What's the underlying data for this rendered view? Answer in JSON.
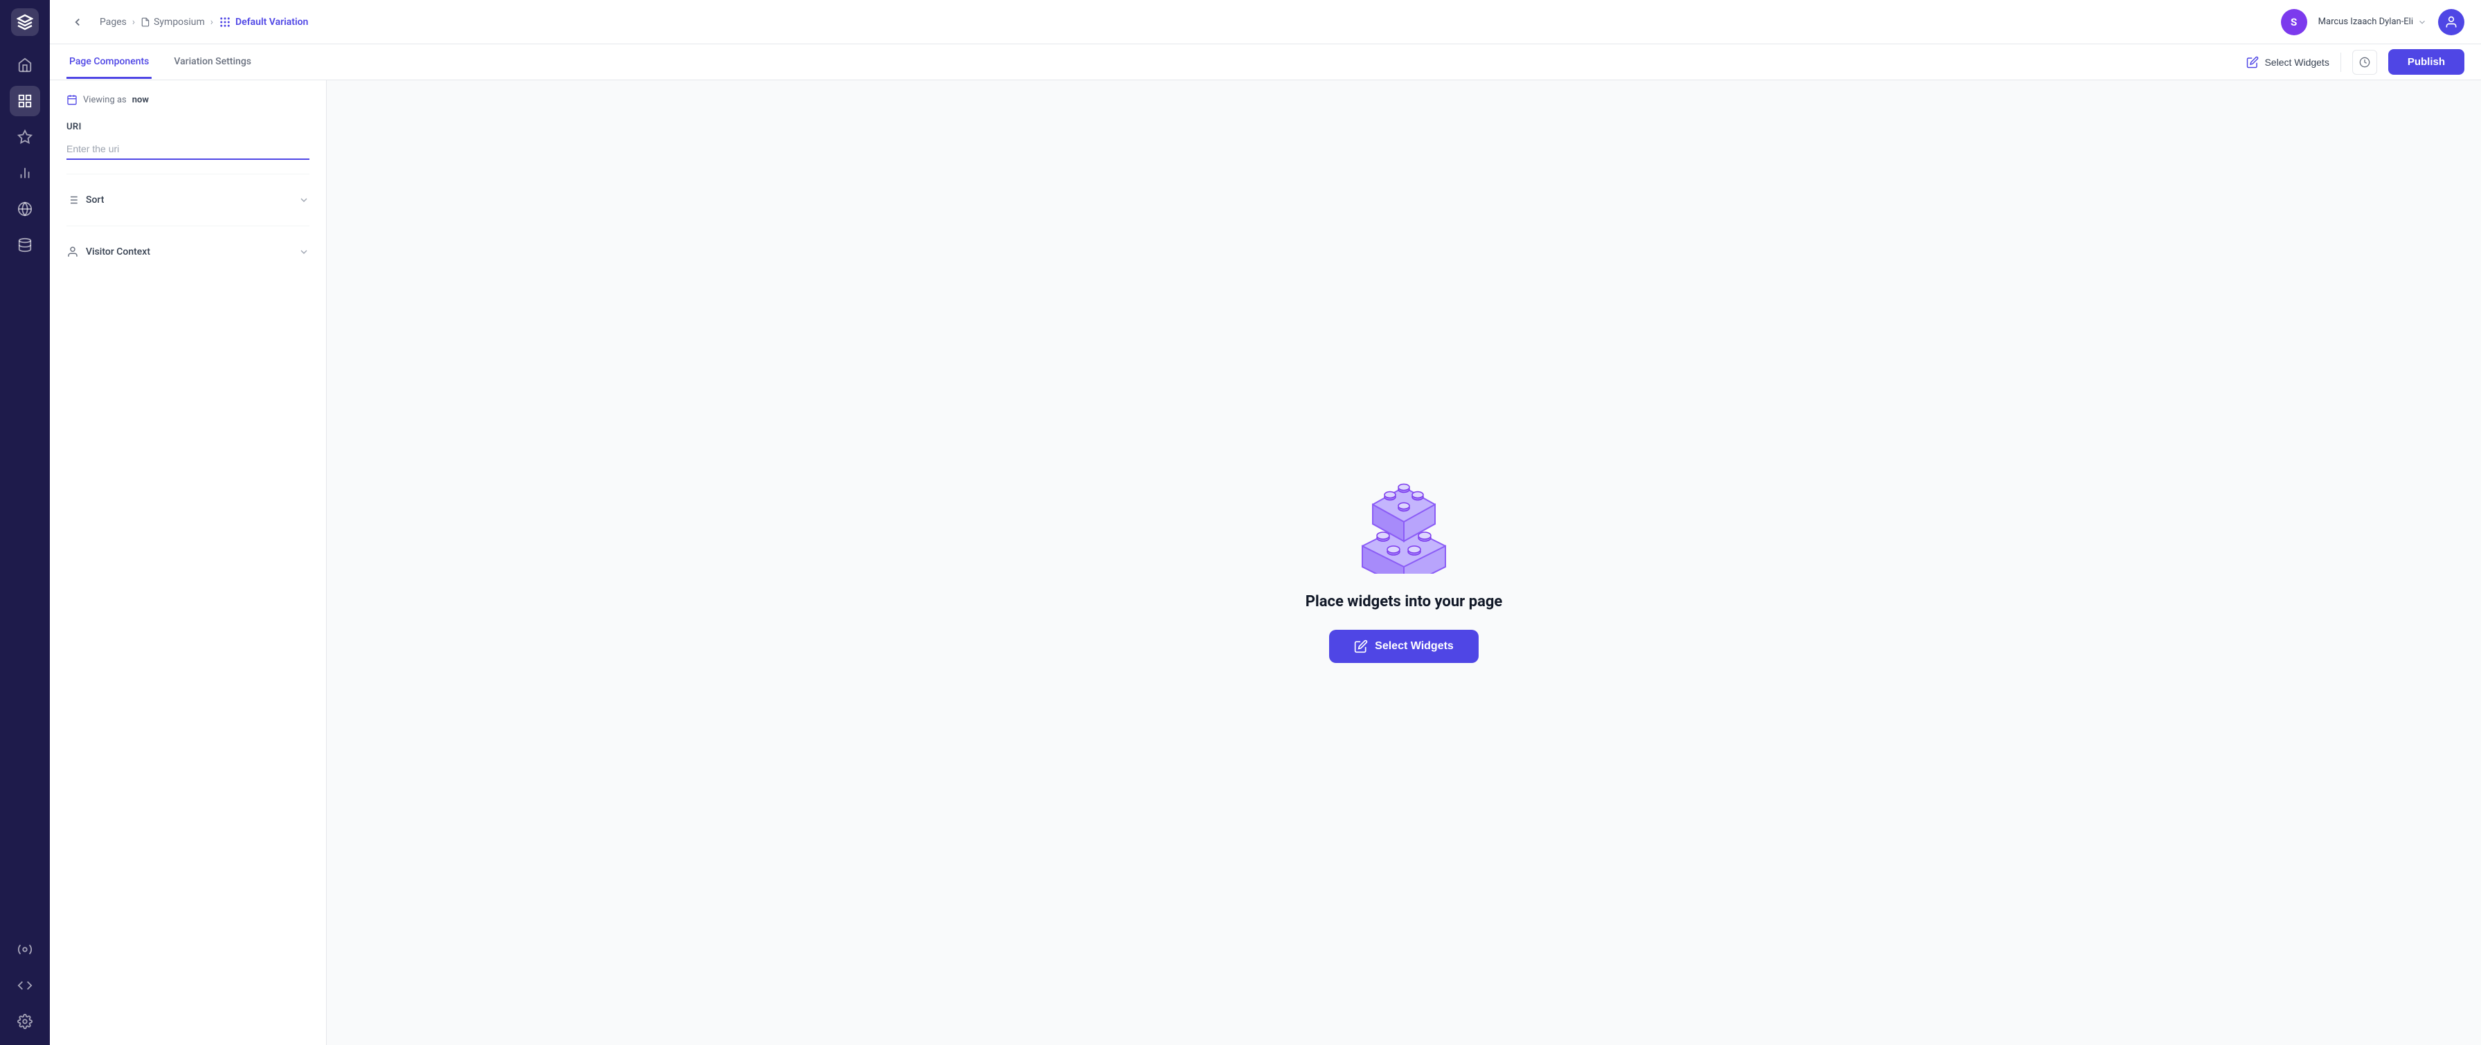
{
  "sidebar": {
    "items": [
      {
        "name": "home",
        "label": "Home",
        "active": false
      },
      {
        "name": "pages",
        "label": "Pages",
        "active": true
      },
      {
        "name": "plugins",
        "label": "Plugins",
        "active": false
      },
      {
        "name": "analytics",
        "label": "Analytics",
        "active": false
      },
      {
        "name": "globe",
        "label": "Globe",
        "active": false
      },
      {
        "name": "database",
        "label": "Database",
        "active": false
      },
      {
        "name": "integrations",
        "label": "Integrations",
        "active": false
      },
      {
        "name": "code",
        "label": "Code",
        "active": false
      },
      {
        "name": "settings",
        "label": "Settings",
        "active": false
      }
    ]
  },
  "breadcrumb": {
    "pages": "Pages",
    "symposium": "Symposium",
    "current": "Default Variation"
  },
  "topbar": {
    "user_initial": "S",
    "user_name": "Marcus Izaach Dylan-Eli",
    "publish_label": "Publish"
  },
  "tabs": {
    "items": [
      {
        "id": "page-components",
        "label": "Page Components",
        "active": true
      },
      {
        "id": "variation-settings",
        "label": "Variation Settings",
        "active": false
      }
    ],
    "select_widgets_label": "Select Widgets",
    "publish_label": "Publish"
  },
  "left_panel": {
    "viewing_as_prefix": "Viewing as",
    "viewing_as_value": "now",
    "uri_label": "URI",
    "uri_placeholder": "Enter the uri",
    "sort_label": "Sort",
    "visitor_context_label": "Visitor Context"
  },
  "canvas": {
    "empty_title": "Place widgets into your page",
    "select_widgets_label": "Select Widgets"
  }
}
